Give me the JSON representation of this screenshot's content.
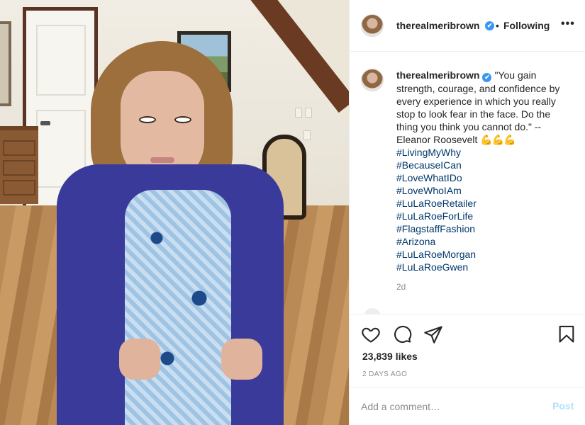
{
  "post": {
    "username": "therealmeribrown",
    "verified_mark": "✔",
    "separator": "•",
    "follow_status": "Following",
    "more_label": "•••"
  },
  "caption": {
    "username": "therealmeribrown",
    "text": "\"You gain strength, courage, and confidence by every experience in which you really stop to look fear in the face. Do the thing you think you cannot do.\" -- Eleanor Roosevelt ",
    "emoji": "💪💪💪",
    "hashtags": [
      "#LivingMyWhy",
      "#BecauseICan",
      "#LoveWhatIDo",
      "#LoveWhoIAm",
      "#LuLaRoeRetailer",
      "#LuLaRoeForLife",
      "#FlagstaffFashion",
      "#Arizona",
      "#LuLaRoeMorgan",
      "#LuLaRoeGwen"
    ],
    "age": "2d"
  },
  "icons": {
    "like": "heart-icon",
    "comment": "comment-icon",
    "share": "paper-plane-icon",
    "save": "bookmark-icon"
  },
  "engagement": {
    "likes": "23,839 likes",
    "timestamp": "2 DAYS AGO"
  },
  "comment": {
    "placeholder": "Add a comment…",
    "post_label": "Post"
  },
  "colors": {
    "verified": "#3897f0",
    "hashtag": "#00376b",
    "post_disabled": "#b2dffc",
    "muted": "#8e8e8e"
  }
}
